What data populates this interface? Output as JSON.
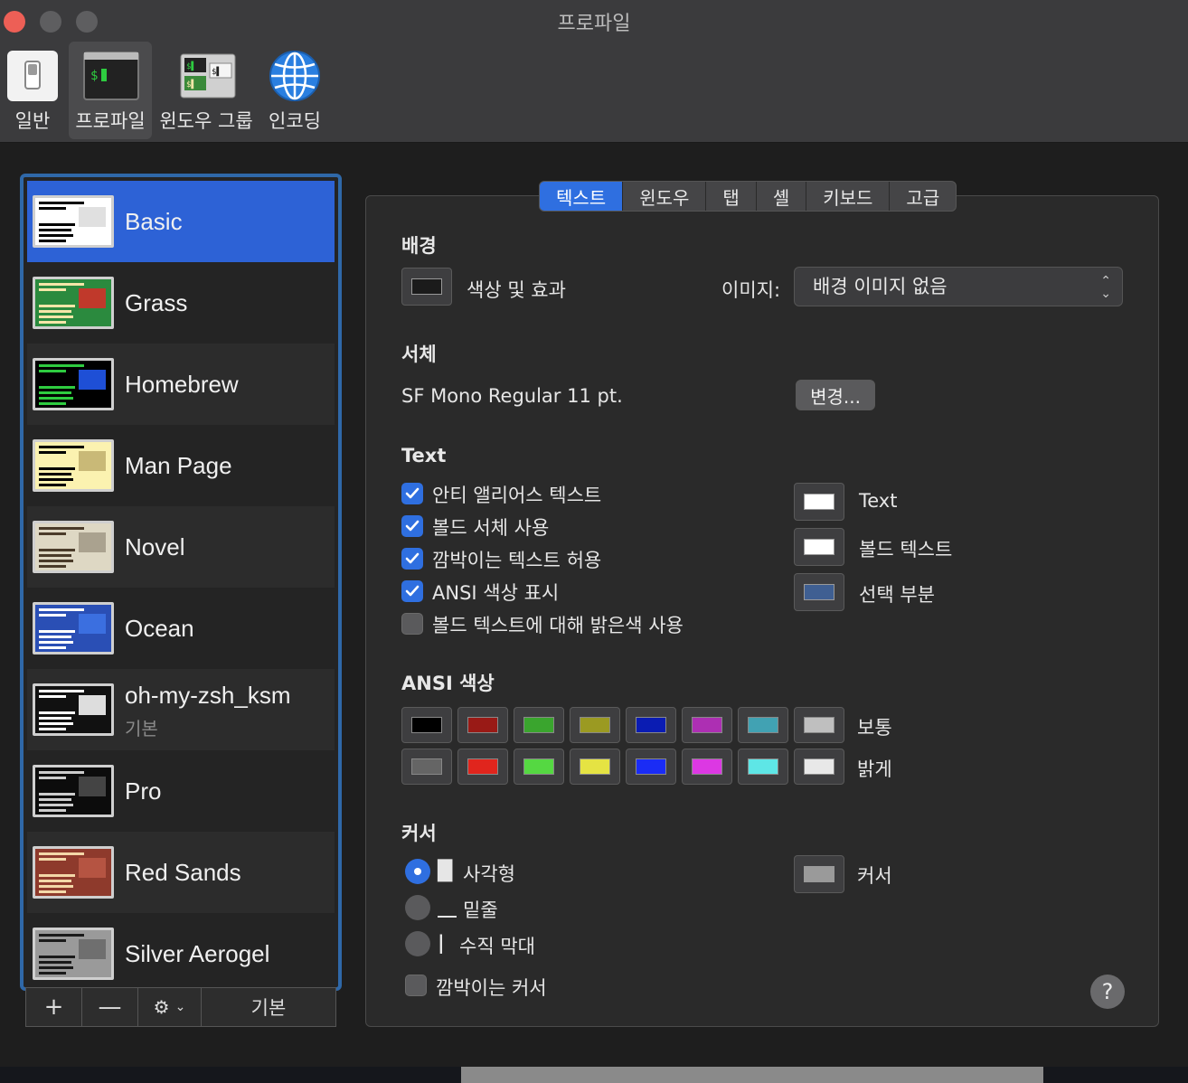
{
  "window": {
    "title": "프로파일"
  },
  "toolbar": {
    "items": [
      {
        "label": "일반",
        "icon": "switch-icon"
      },
      {
        "label": "프로파일",
        "icon": "terminal-icon"
      },
      {
        "label": "윈도우 그룹",
        "icon": "window-group-icon"
      },
      {
        "label": "인코딩",
        "icon": "globe-icon"
      }
    ],
    "active_index": 1
  },
  "sidebar": {
    "profiles": [
      {
        "name": "Basic",
        "sub": "",
        "thumb_bg": "#ffffff",
        "thumb_fg": "#000000",
        "thumb_accent": "#e0e0e0"
      },
      {
        "name": "Grass",
        "sub": "",
        "thumb_bg": "#2b8a3e",
        "thumb_fg": "#f5e6a8",
        "thumb_accent": "#c0392b"
      },
      {
        "name": "Homebrew",
        "sub": "",
        "thumb_bg": "#000000",
        "thumb_fg": "#2ecc40",
        "thumb_accent": "#1e4fd6"
      },
      {
        "name": "Man Page",
        "sub": "",
        "thumb_bg": "#fbf2b0",
        "thumb_fg": "#000000",
        "thumb_accent": "#c9b977"
      },
      {
        "name": "Novel",
        "sub": "",
        "thumb_bg": "#ded8c4",
        "thumb_fg": "#4a3b2a",
        "thumb_accent": "#aaa28f"
      },
      {
        "name": "Ocean",
        "sub": "",
        "thumb_bg": "#2a4fb5",
        "thumb_fg": "#ffffff",
        "thumb_accent": "#3b6fe0"
      },
      {
        "name": "oh-my-zsh_ksm",
        "sub": "기본",
        "thumb_bg": "#111111",
        "thumb_fg": "#ffffff",
        "thumb_accent": "#dddddd"
      },
      {
        "name": "Pro",
        "sub": "",
        "thumb_bg": "#0c0c0c",
        "thumb_fg": "#cccccc",
        "thumb_accent": "#444444"
      },
      {
        "name": "Red Sands",
        "sub": "",
        "thumb_bg": "#8e3a2c",
        "thumb_fg": "#f3d8a8",
        "thumb_accent": "#b55442"
      },
      {
        "name": "Silver Aerogel",
        "sub": "",
        "thumb_bg": "#9a9a9a",
        "thumb_fg": "#1a1a1a",
        "thumb_accent": "#6f6f6f"
      }
    ],
    "selected_index": 0,
    "buttons": {
      "add": "+",
      "remove": "—",
      "gear": "⚙",
      "default": "기본"
    }
  },
  "tabs": {
    "items": [
      "텍스트",
      "윈도우",
      "탭",
      "셸",
      "키보드",
      "고급"
    ],
    "active_index": 0
  },
  "background": {
    "title": "배경",
    "color_effects_label": "색상 및 효과",
    "image_label": "이미지:",
    "image_value": "배경 이미지 없음",
    "swatch_color": "#1b1b1b"
  },
  "font": {
    "title": "서체",
    "value": "SF Mono Regular 11 pt.",
    "change_button": "변경..."
  },
  "text": {
    "title": "Text",
    "options": [
      {
        "label": "안티 앨리어스 텍스트",
        "checked": true
      },
      {
        "label": "볼드 서체 사용",
        "checked": true
      },
      {
        "label": "깜박이는 텍스트 허용",
        "checked": true
      },
      {
        "label": "ANSI 색상 표시",
        "checked": true
      },
      {
        "label": "볼드 텍스트에 대해 밝은색 사용",
        "checked": false
      }
    ],
    "colors": [
      {
        "label": "Text",
        "color": "#ffffff"
      },
      {
        "label": "볼드 텍스트",
        "color": "#ffffff"
      },
      {
        "label": "선택 부분",
        "color": "#3f5f92"
      }
    ]
  },
  "ansi": {
    "title": "ANSI 색상",
    "normal_label": "보통",
    "bright_label": "밝게",
    "normal": [
      "#000000",
      "#991a16",
      "#3aa52e",
      "#9b9a22",
      "#0a1cb3",
      "#ad2fb3",
      "#41a2b3",
      "#bfbfbf"
    ],
    "bright": [
      "#656565",
      "#e0251d",
      "#55d842",
      "#e5e343",
      "#1a2cf5",
      "#dc38e3",
      "#5ee6e6",
      "#e8e8e8"
    ]
  },
  "cursor": {
    "title": "커서",
    "options": [
      {
        "glyph": "█",
        "label": "사각형",
        "selected": true
      },
      {
        "glyph": "__",
        "label": "밑줄",
        "selected": false
      },
      {
        "glyph": "|",
        "label": "수직 막대",
        "selected": false
      }
    ],
    "blink_label": "깜박이는 커서",
    "blink_checked": false,
    "color_label": "커서",
    "color": "#9a9a9a"
  },
  "help": "?"
}
